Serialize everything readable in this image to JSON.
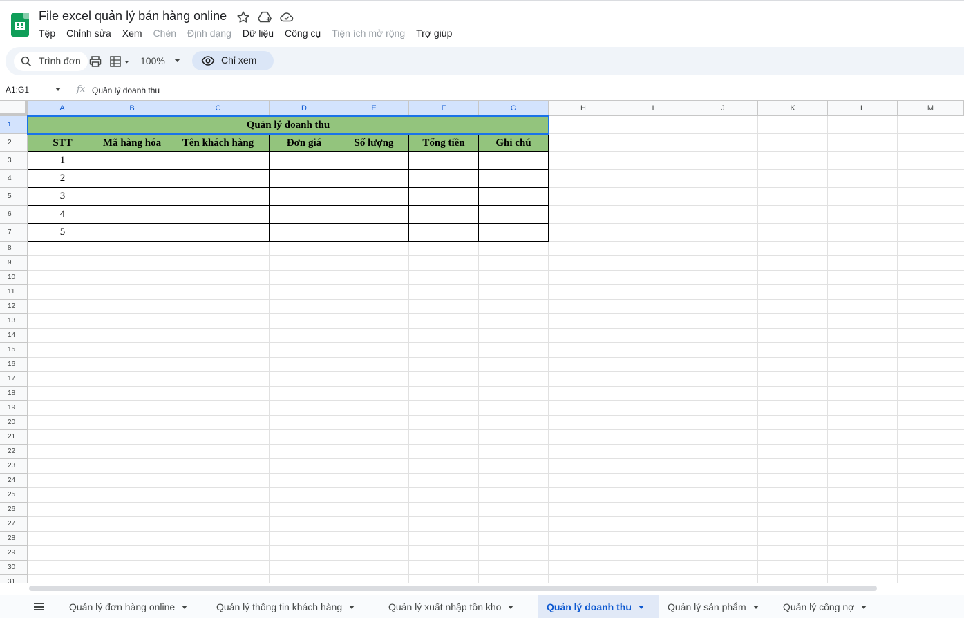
{
  "app": {
    "doc_title": "File excel quản lý bán hàng online",
    "menu": [
      {
        "label": "Tệp",
        "enabled": true
      },
      {
        "label": "Chỉnh sửa",
        "enabled": true
      },
      {
        "label": "Xem",
        "enabled": true
      },
      {
        "label": "Chèn",
        "enabled": false
      },
      {
        "label": "Định dạng",
        "enabled": false
      },
      {
        "label": "Dữ liệu",
        "enabled": true
      },
      {
        "label": "Công cụ",
        "enabled": true
      },
      {
        "label": "Tiện ích mở rộng",
        "enabled": false
      },
      {
        "label": "Trợ giúp",
        "enabled": true
      }
    ]
  },
  "toolbar": {
    "search_label": "Trình đơn",
    "zoom": "100%",
    "view_mode": "Chỉ xem"
  },
  "formula_bar": {
    "range": "A1:G1",
    "fx": "fx",
    "value": "Quản lý doanh thu"
  },
  "grid": {
    "columns": [
      "A",
      "B",
      "C",
      "D",
      "E",
      "F",
      "G",
      "H",
      "I",
      "J",
      "K",
      "L",
      "M"
    ],
    "rows": [
      "1",
      "2",
      "3",
      "4",
      "5",
      "6",
      "7",
      "8",
      "9",
      "10",
      "11",
      "12",
      "13",
      "14",
      "15",
      "16",
      "17",
      "18",
      "19",
      "20",
      "21",
      "22",
      "23",
      "24",
      "25",
      "26",
      "27",
      "28",
      "29",
      "30",
      "31"
    ],
    "title": "Quản lý doanh thu",
    "headers": [
      "STT",
      "Mã hàng hóa",
      "Tên khách hàng",
      "Đơn giá",
      "Số lượng",
      "Tổng tiền",
      "Ghi chú"
    ],
    "stt": [
      "1",
      "2",
      "3",
      "4",
      "5"
    ]
  },
  "sheets": [
    {
      "label": "Quản lý đơn hàng online",
      "active": false
    },
    {
      "label": "Quản lý thông tin khách hàng",
      "active": false
    },
    {
      "label": "Quản lý xuất nhập tồn kho",
      "active": false
    },
    {
      "label": "Quản lý doanh thu",
      "active": true
    },
    {
      "label": "Quản lý sản phẩm",
      "active": false
    },
    {
      "label": "Quản lý công nợ",
      "active": false
    }
  ],
  "colors": {
    "header_fill": "#93c47d",
    "selection": "#1a73e8",
    "active_tab_text": "#0b57d0"
  }
}
